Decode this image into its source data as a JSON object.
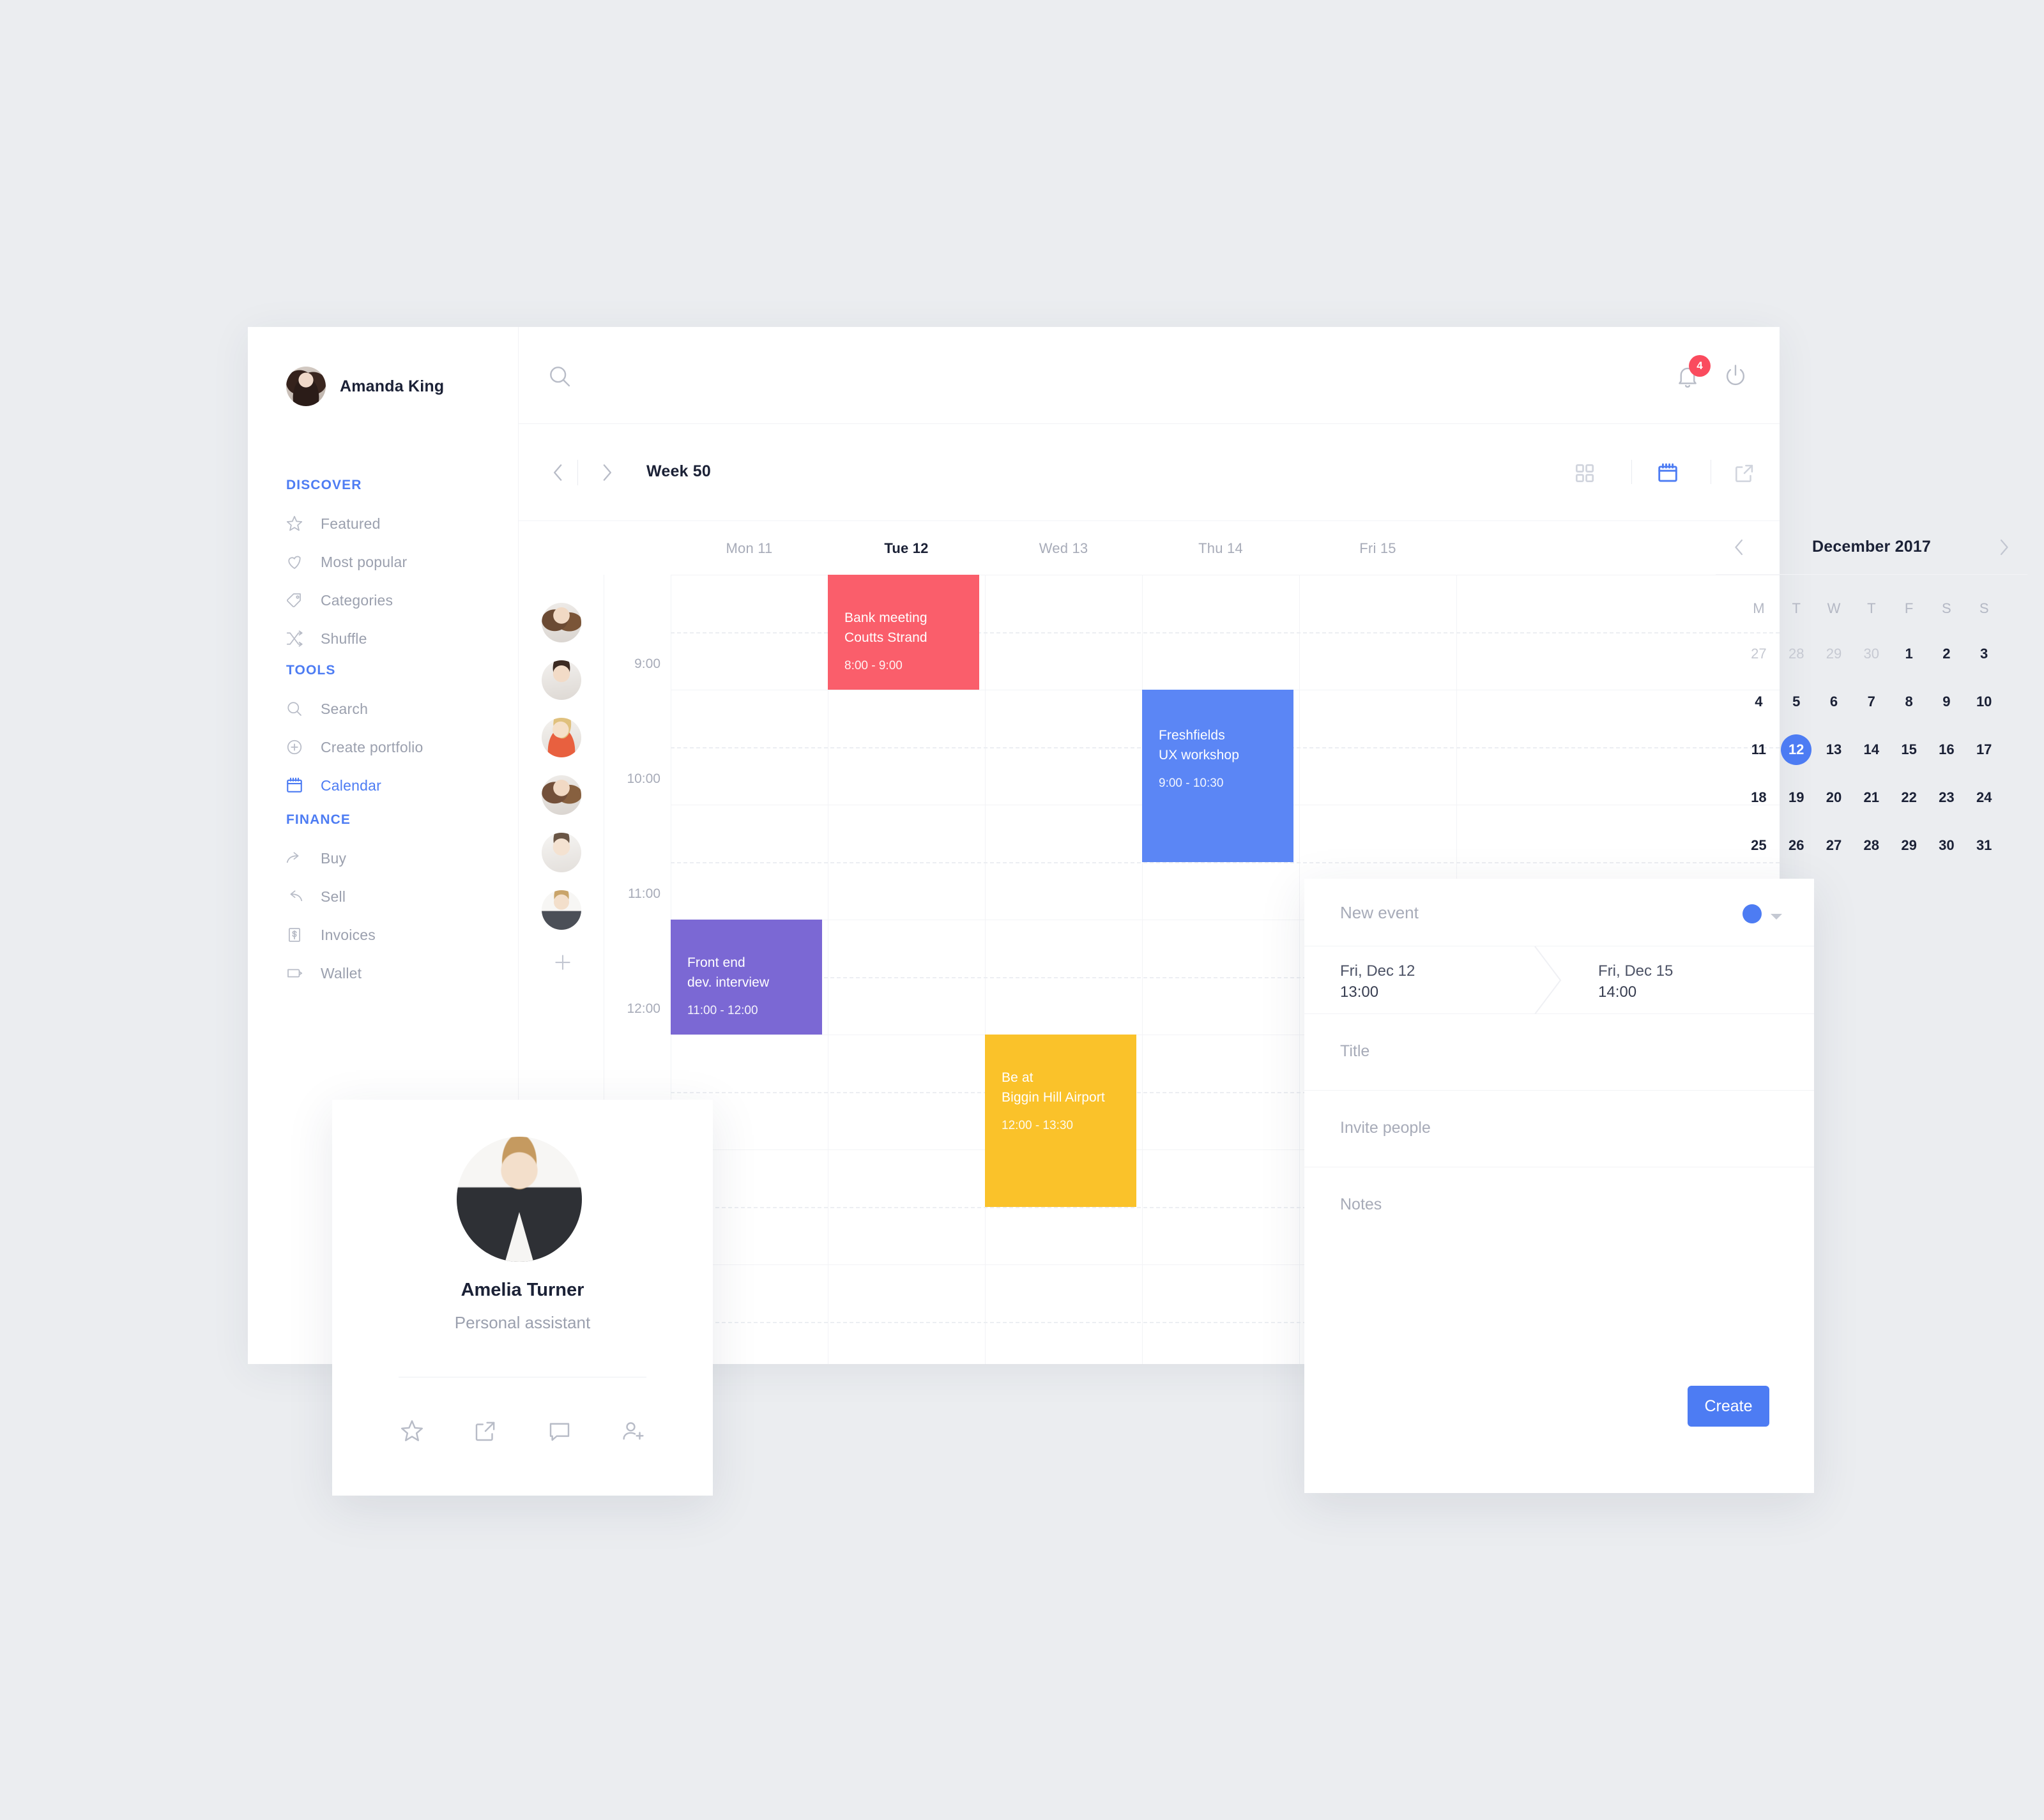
{
  "user": {
    "name": "Amanda King",
    "avatar_icon": "user-avatar"
  },
  "topbar": {
    "search_icon": "search-icon",
    "notifications_icon": "bell-icon",
    "notifications_count": "4",
    "logout_icon": "power-icon"
  },
  "sidebar": {
    "sections": [
      {
        "title": "DISCOVER",
        "items": [
          {
            "label": "Featured",
            "icon": "star-icon",
            "active": false
          },
          {
            "label": "Most popular",
            "icon": "heart-icon",
            "active": false
          },
          {
            "label": "Categories",
            "icon": "tag-icon",
            "active": false
          },
          {
            "label": "Shuffle",
            "icon": "shuffle-icon",
            "active": false
          }
        ]
      },
      {
        "title": "TOOLS",
        "items": [
          {
            "label": "Search",
            "icon": "search-icon",
            "active": false
          },
          {
            "label": "Create portfolio",
            "icon": "plus-circle-icon",
            "active": false
          },
          {
            "label": "Calendar",
            "icon": "calendar-icon",
            "active": true
          }
        ]
      },
      {
        "title": "FINANCE",
        "items": [
          {
            "label": "Buy",
            "icon": "arrow-forward-icon",
            "active": false
          },
          {
            "label": "Sell",
            "icon": "arrow-back-icon",
            "active": false
          },
          {
            "label": "Invoices",
            "icon": "invoice-icon",
            "active": false
          },
          {
            "label": "Wallet",
            "icon": "wallet-icon",
            "active": false
          }
        ]
      }
    ]
  },
  "weekbar": {
    "prev_icon": "chevron-left-icon",
    "next_icon": "chevron-right-icon",
    "title": "Week 50",
    "views": [
      {
        "icon": "grid-view-icon",
        "active": false
      },
      {
        "icon": "calendar-view-icon",
        "active": true
      },
      {
        "icon": "external-link-icon",
        "active": false
      }
    ]
  },
  "calendar": {
    "days": [
      {
        "label": "Mon 11",
        "today": false
      },
      {
        "label": "Tue 12",
        "today": true
      },
      {
        "label": "Wed 13",
        "today": false
      },
      {
        "label": "Thu 14",
        "today": false
      },
      {
        "label": "Fri 15",
        "today": false
      }
    ],
    "times": [
      "9:00",
      "10:00",
      "11:00",
      "12:00"
    ],
    "add_person_icon": "plus-icon",
    "attendee_count": 6,
    "events": [
      {
        "title_line1": "Bank meeting",
        "title_line2": "Coutts Strand",
        "time": "8:00 - 9:00",
        "color": "#FA5E6B",
        "day_index": 1,
        "start_hour": 8.0,
        "end_hour": 9.0
      },
      {
        "title_line1": "Freshfields",
        "title_line2": "UX workshop",
        "time": "9:00 - 10:30",
        "color": "#5B86F5",
        "day_index": 3,
        "start_hour": 9.0,
        "end_hour": 10.5
      },
      {
        "title_line1": "Front end",
        "title_line2": "dev. interview",
        "time": "11:00 - 12:00",
        "color": "#7B68D4",
        "day_index": 0,
        "start_hour": 11.0,
        "end_hour": 12.0
      },
      {
        "title_line1": "Be at",
        "title_line2": "Biggin Hill Airport",
        "time": "12:00 - 13:30",
        "color": "#FAC22A",
        "day_index": 2,
        "start_hour": 12.0,
        "end_hour": 13.5
      }
    ]
  },
  "mini_calendar": {
    "prev_icon": "chevron-left-icon",
    "next_icon": "chevron-right-icon",
    "month": "December 2017",
    "dow": [
      "M",
      "T",
      "W",
      "T",
      "F",
      "S",
      "S"
    ],
    "weeks": [
      [
        {
          "d": "27",
          "muted": true
        },
        {
          "d": "28",
          "muted": true
        },
        {
          "d": "29",
          "muted": true
        },
        {
          "d": "30",
          "muted": true
        },
        {
          "d": "1"
        },
        {
          "d": "2"
        },
        {
          "d": "3"
        }
      ],
      [
        {
          "d": "4"
        },
        {
          "d": "5"
        },
        {
          "d": "6"
        },
        {
          "d": "7"
        },
        {
          "d": "8"
        },
        {
          "d": "9"
        },
        {
          "d": "10"
        }
      ],
      [
        {
          "d": "11"
        },
        {
          "d": "12",
          "selected": true
        },
        {
          "d": "13"
        },
        {
          "d": "14"
        },
        {
          "d": "15"
        },
        {
          "d": "16"
        },
        {
          "d": "17"
        }
      ],
      [
        {
          "d": "18"
        },
        {
          "d": "19"
        },
        {
          "d": "20"
        },
        {
          "d": "21"
        },
        {
          "d": "22"
        },
        {
          "d": "23"
        },
        {
          "d": "24"
        }
      ],
      [
        {
          "d": "25"
        },
        {
          "d": "26"
        },
        {
          "d": "27"
        },
        {
          "d": "28"
        },
        {
          "d": "29"
        },
        {
          "d": "30"
        },
        {
          "d": "31"
        }
      ]
    ]
  },
  "new_event": {
    "heading": "New event",
    "color_dot": "#4D7CF3",
    "color_caret_icon": "caret-down-icon",
    "start_date": "Fri, Dec 12",
    "start_time": "13:00",
    "end_date": "Fri, Dec 15",
    "end_time": "14:00",
    "title_placeholder": "Title",
    "invite_placeholder": "Invite people",
    "notes_placeholder": "Notes",
    "create_label": "Create"
  },
  "profile_card": {
    "name": "Amelia Turner",
    "role": "Personal assistant",
    "actions": [
      {
        "icon": "star-icon"
      },
      {
        "icon": "external-link-icon"
      },
      {
        "icon": "comment-icon"
      },
      {
        "icon": "add-person-icon"
      }
    ]
  }
}
